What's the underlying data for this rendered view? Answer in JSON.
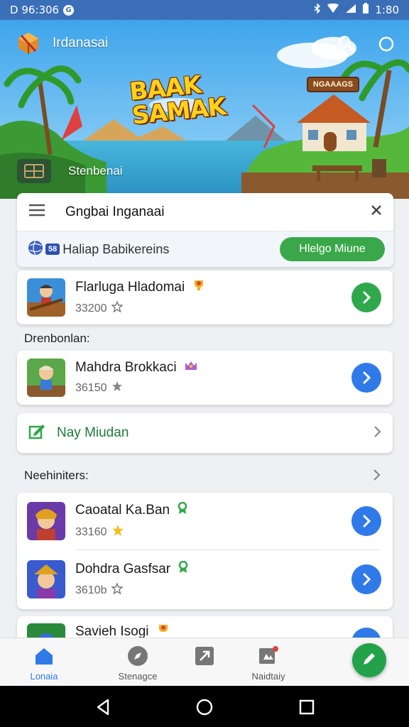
{
  "status_bar": {
    "time_left": "D 96:306",
    "time_right": "1:80",
    "notification_badge": "G"
  },
  "header": {
    "app_title": "Irdanasai",
    "logo_text_line1": "BAAK",
    "logo_text_line2": "SAMAK",
    "sign_text": "NGAAAGS",
    "chip_label": "Stenbenai"
  },
  "panel": {
    "title": "Gngbai Inganaai",
    "subtitle": "Haliap Babikereins",
    "badge_text": "58",
    "action_label": "Hlelgo Miune"
  },
  "featured": {
    "title": "Flarluga Hladomai",
    "meta": "33200"
  },
  "section_1": {
    "label": "Drenbonlan:"
  },
  "item_1": {
    "title": "Mahdra Brokkaci",
    "meta": "36150"
  },
  "link_row": {
    "label": "Nay Miudan"
  },
  "section_2": {
    "label": "Neehiniters:"
  },
  "list": [
    {
      "title": "Caoatal Ka.Ban",
      "meta": "33160"
    },
    {
      "title": "Dohdra Gasfsar",
      "meta": "3610b"
    },
    {
      "title": "Savieh Isogi",
      "meta": ""
    }
  ],
  "bottom_nav": [
    {
      "label": "Lonaia",
      "icon": "home-icon",
      "active": true
    },
    {
      "label": "Stenagce",
      "icon": "compass-icon",
      "active": false
    },
    {
      "label": "",
      "icon": "share-icon",
      "active": false
    },
    {
      "label": "Naidtaiy",
      "icon": "notification-icon",
      "active": false
    }
  ],
  "colors": {
    "status_bar": "#3a6fb8",
    "primary_blue": "#2f7ae8",
    "primary_green": "#2ea84a",
    "link_green": "#1e7a3c"
  }
}
